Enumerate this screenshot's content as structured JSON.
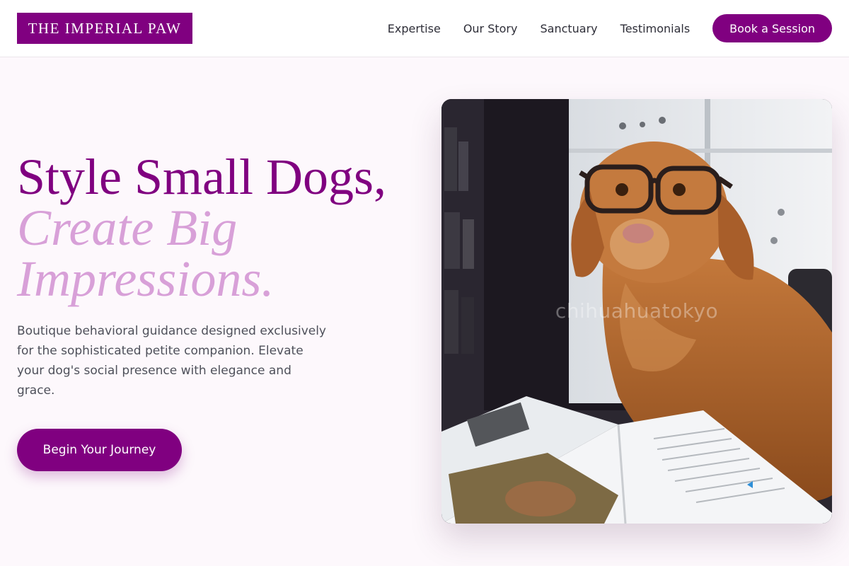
{
  "header": {
    "logo_text": "THE IMPERIAL PAW",
    "nav": [
      {
        "label": "Expertise"
      },
      {
        "label": "Our Story"
      },
      {
        "label": "Sanctuary"
      },
      {
        "label": "Testimonials"
      }
    ],
    "cta_label": "Book a Session"
  },
  "hero": {
    "title_line1": "Style Small Dogs,",
    "title_line2": "Create Big Impressions.",
    "description": "Boutique behavioral guidance designed exclusively for the sophisticated petite companion. Elevate your dog's social presence with elegance and grace.",
    "cta_label": "Begin Your Journey",
    "image": {
      "subject": "dog-wearing-glasses-reading-magazine",
      "watermark": "chihuahuatokyo"
    }
  },
  "colors": {
    "brand": "#800080",
    "accent_light": "#d8a0d8",
    "page_background": "#fdf8fc",
    "body_text": "#4e505a"
  }
}
